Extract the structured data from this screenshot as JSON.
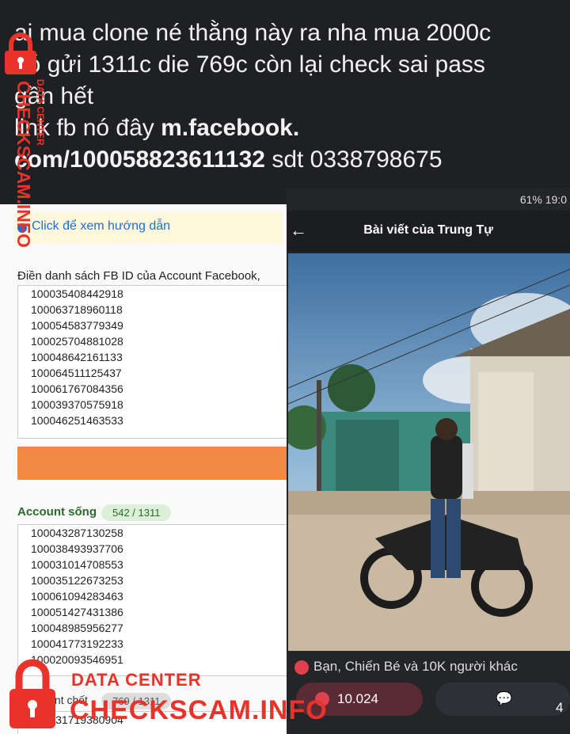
{
  "caption": {
    "line1": "ai mua clone né thằng này ra nha mua 2000c",
    "line2": "nó gửi 1311c die 769c còn lại check sai pass",
    "line3": "gần hết",
    "line4_prefix": "link fb nó đây ",
    "line4_link": "m.facebook.",
    "line5_link": "com/100058823611132",
    "line5_suffix": " sdt 0338798675"
  },
  "left_panel": {
    "hint_text": "Click để xem hướng dẫn",
    "list_label": "Điền danh sách FB ID của Account Facebook,",
    "ids_input": [
      "100035408442918",
      "100063718960118",
      "100054583779349",
      "100025704881028",
      "100048642161133",
      "100064511125437",
      "100061767084356",
      "100039370575918",
      "100046251463533"
    ],
    "live_label": "Account sống",
    "live_count": "542 / 1311",
    "ids_live": [
      "100043287130258",
      "100038493937706",
      "100031014708553",
      "100035122673253",
      "100061094283463",
      "100051427431386",
      "100048985956277",
      "100041773192233",
      "100020093546951"
    ],
    "dead_label": "Account chết",
    "dead_count": "769 / 1311",
    "ids_dead": [
      "100031719380904"
    ]
  },
  "right_panel": {
    "status": "61%  19:0",
    "title": "Bài viết của Trung Tự",
    "reactions": "Bạn, Chiến Bé và 10K người khác",
    "like_count": "10.024",
    "comment_count": "4"
  },
  "watermark": {
    "brand_top": "DATA CENTER",
    "brand_bottom": "CHECKSCAM.INFO",
    "vertical": "CHECKSCAM.INFO",
    "vertical_small": "DATA CENTER"
  },
  "colors": {
    "accent_red": "#e8322a",
    "orange_bar": "#f08a43",
    "fb_like": "#e0414f"
  }
}
